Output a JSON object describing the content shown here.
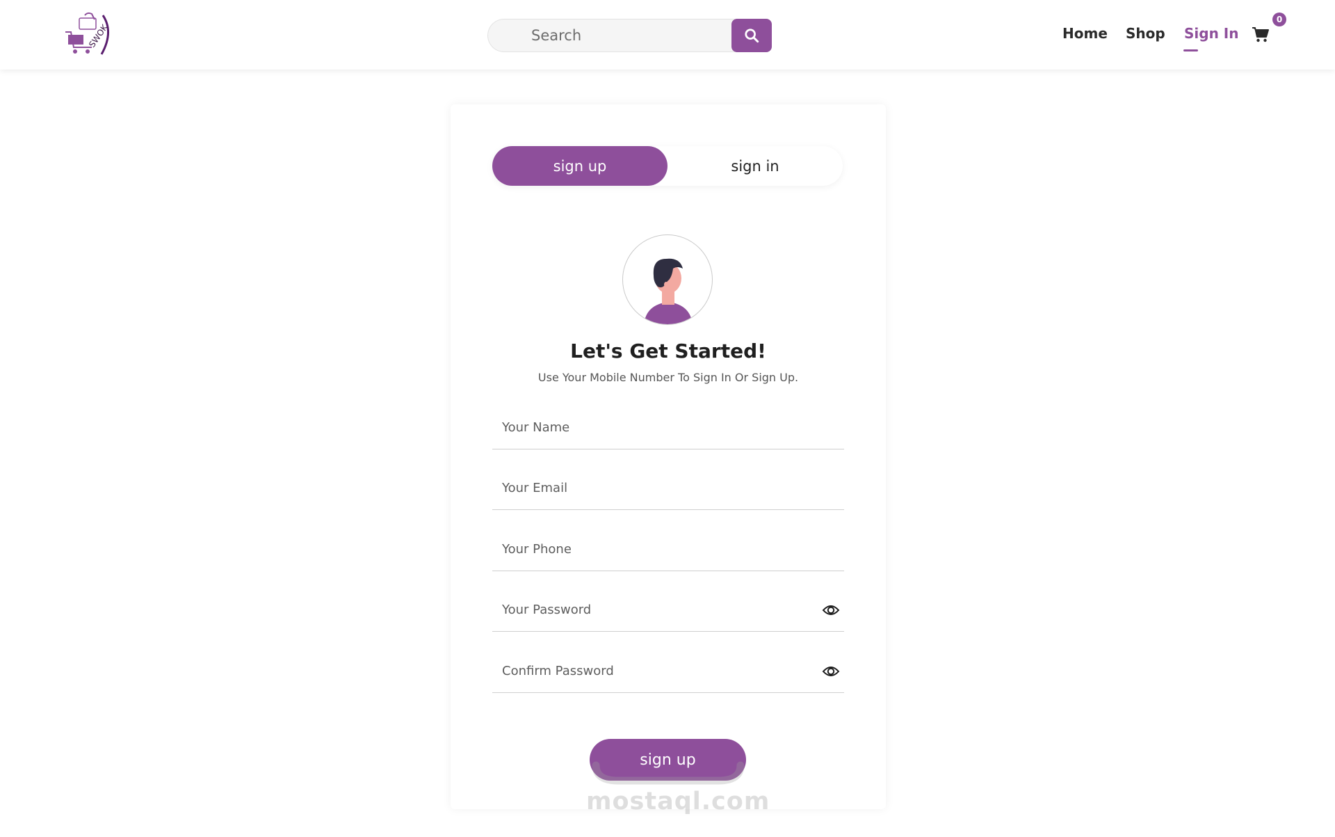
{
  "header": {
    "logo_text": "SWOK",
    "search": {
      "placeholder": "Search",
      "value": ""
    },
    "nav": {
      "home": "Home",
      "shop": "Shop",
      "signin": "Sign In",
      "active": "Sign In"
    },
    "cart": {
      "count": "0",
      "icon": "cart-icon"
    }
  },
  "auth": {
    "tabs": {
      "signup": "sign up",
      "signin": "sign in",
      "active": "sign up"
    },
    "title": "Let's Get Started!",
    "subtitle": "Use Your Mobile Number To Sign In Or Sign Up.",
    "fields": {
      "name": {
        "placeholder": "Your Name",
        "value": ""
      },
      "email": {
        "placeholder": "Your Email",
        "value": ""
      },
      "phone": {
        "placeholder": "Your Phone",
        "value": ""
      },
      "password": {
        "placeholder": "Your Password",
        "value": "",
        "icon": "eye-icon"
      },
      "confirm": {
        "placeholder": "Confirm Password",
        "value": "",
        "icon": "eye-icon"
      }
    },
    "submit_label": "sign up"
  },
  "watermark": "mostaql.com",
  "colors": {
    "accent": "#8e4f9b",
    "text": "#222222",
    "border": "#cfcfcf",
    "background": "#ffffff"
  }
}
